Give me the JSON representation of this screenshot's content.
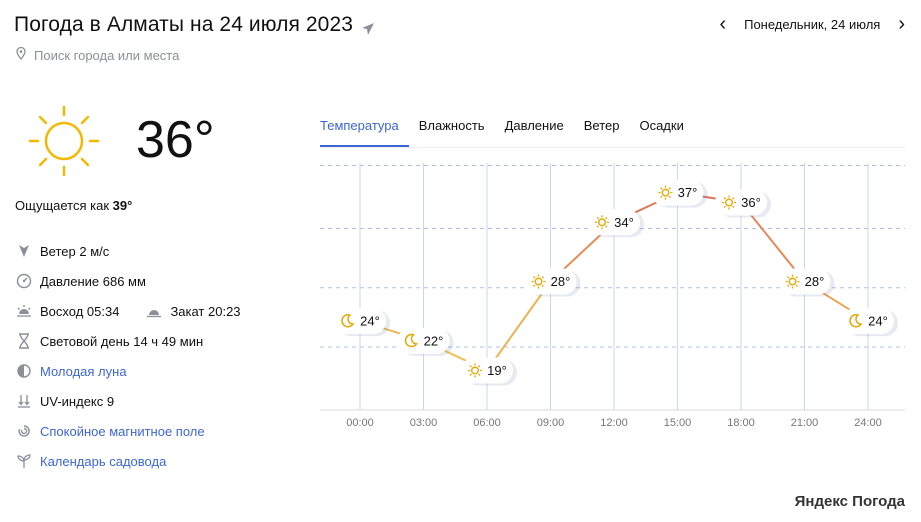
{
  "header": {
    "title": "Погода в Алматы на 24 июля 2023",
    "search_placeholder": "Поиск города или места",
    "date_label": "Понедельник, 24 июля"
  },
  "current": {
    "temperature": "36°",
    "feels_like_label": "Ощущается как",
    "feels_like_value": "39°",
    "icon": "sun-icon"
  },
  "details": {
    "wind": "Ветер 2 м/с",
    "pressure": "Давление 686 мм",
    "sunrise": "Восход 05:34",
    "sunset": "Закат 20:23",
    "daylight": "Световой день 14 ч 49 мин",
    "moon": "Молодая луна",
    "uv": "UV-индекс 9",
    "magnetic": "Спокойное магнитное поле",
    "garden": "Календарь садовода"
  },
  "tabs": [
    "Температура",
    "Влажность",
    "Давление",
    "Ветер",
    "Осадки"
  ],
  "active_tab": 0,
  "colors": {
    "accent": "#3d66d6",
    "line_cool": "#f2c14e",
    "line_hot": "#e07058"
  },
  "chart_data": {
    "type": "line",
    "x": [
      "00:00",
      "03:00",
      "06:00",
      "09:00",
      "12:00",
      "15:00",
      "18:00",
      "21:00",
      "24:00"
    ],
    "points": [
      {
        "x": 0,
        "y": 24,
        "label": "24°",
        "icon": "moon"
      },
      {
        "x": 1,
        "y": 22,
        "label": "22°",
        "icon": "moon"
      },
      {
        "x": 2,
        "y": 19,
        "label": "19°",
        "icon": "sun"
      },
      {
        "x": 3,
        "y": 28,
        "label": "28°",
        "icon": "sun"
      },
      {
        "x": 4,
        "y": 34,
        "label": "34°",
        "icon": "sun"
      },
      {
        "x": 5,
        "y": 37,
        "label": "37°",
        "icon": "sun"
      },
      {
        "x": 6,
        "y": 36,
        "label": "36°",
        "icon": "sun"
      },
      {
        "x": 7,
        "y": 28,
        "label": "28°",
        "icon": "sun"
      },
      {
        "x": 8,
        "y": 24,
        "label": "24°",
        "icon": "moon"
      }
    ],
    "ylim": [
      15,
      40
    ],
    "grid": true
  },
  "brand": "Яндекс Погода"
}
